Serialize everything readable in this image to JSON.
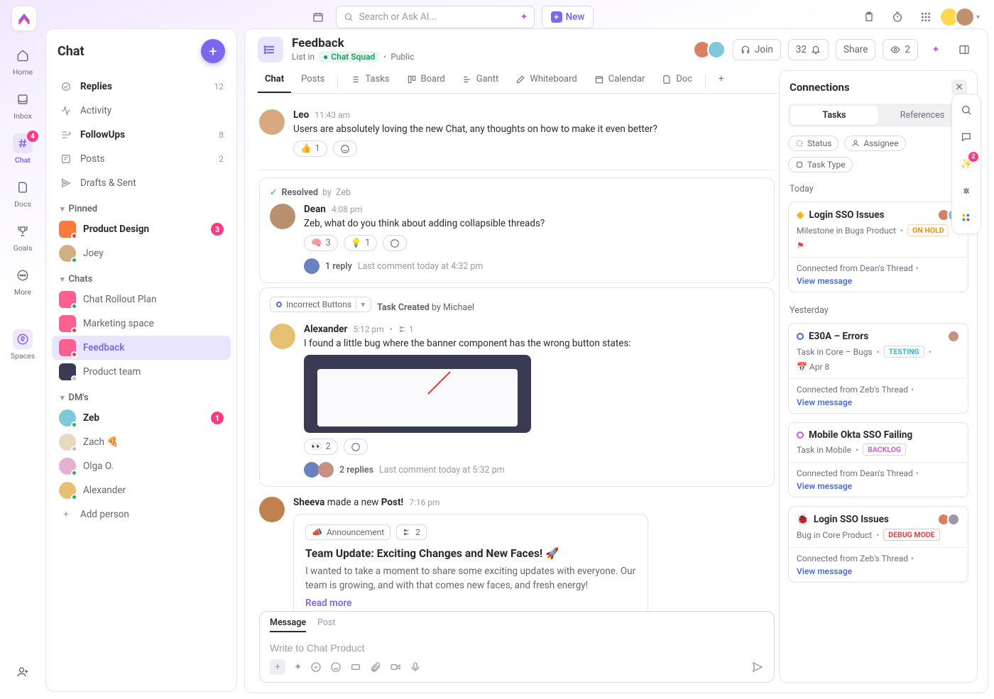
{
  "top": {
    "search_placeholder": "Search or Ask AI...",
    "new_label": "New"
  },
  "rail": {
    "items": [
      {
        "label": "Home"
      },
      {
        "label": "Inbox"
      },
      {
        "label": "Chat",
        "badge": "4"
      },
      {
        "label": "Docs"
      },
      {
        "label": "Goals"
      },
      {
        "label": "More"
      }
    ],
    "spaces_label": "Spaces"
  },
  "panel": {
    "title": "Chat",
    "lists": [
      {
        "icon": "reply",
        "label": "Replies",
        "count": "12",
        "bold": true
      },
      {
        "icon": "activity",
        "label": "Activity"
      },
      {
        "icon": "follow",
        "label": "FollowUps",
        "count": "8",
        "bold": true
      },
      {
        "icon": "post",
        "label": "Posts",
        "count": "2"
      },
      {
        "icon": "draft",
        "label": "Drafts & Sent"
      }
    ],
    "pinned_h": "Pinned",
    "pinned": [
      {
        "label": "Product Design",
        "badge": "3",
        "color": "#ff7a3c",
        "bold": true
      },
      {
        "label": "Joey",
        "avatar": "#d0b080",
        "presence": "#27ae60"
      }
    ],
    "chats_h": "Chats",
    "chats": [
      {
        "label": "Chat Rollout Plan",
        "color": "#ff5f8f"
      },
      {
        "label": "Marketing space",
        "color": "#ff5f8f"
      },
      {
        "label": "Feedback",
        "color": "#ff5f8f",
        "selected": true
      },
      {
        "label": "Product team",
        "color": "#3a3a55"
      }
    ],
    "dms_h": "DM's",
    "dms": [
      {
        "label": "Zeb",
        "avatar": "#7fc8d8",
        "presence": "#27ae60",
        "badge": "1",
        "bold": true
      },
      {
        "label": "Zach 🍕",
        "avatar": "#e9d8c0",
        "presence": "#bdbdc8"
      },
      {
        "label": "Olga O.",
        "avatar": "#e6b0d0",
        "presence": "#27ae60"
      },
      {
        "label": "Alexander",
        "avatar": "#e6c070",
        "presence": "#27ae60"
      }
    ],
    "add_person": "Add person"
  },
  "header": {
    "title": "Feedback",
    "sub_prefix": "List in",
    "folder": "Chat Squad",
    "visibility": "Public",
    "join": "Join",
    "count": "32",
    "share": "Share",
    "views_count": "2"
  },
  "views": [
    {
      "label": "Chat",
      "active": true
    },
    {
      "label": "Posts"
    },
    {
      "label": "Tasks",
      "icon": "list"
    },
    {
      "label": "Board",
      "icon": "board"
    },
    {
      "label": "Gantt",
      "icon": "gantt"
    },
    {
      "label": "Whiteboard",
      "icon": "pen"
    },
    {
      "label": "Calendar",
      "icon": "cal"
    },
    {
      "label": "Doc",
      "icon": "doc"
    }
  ],
  "feed": {
    "m1": {
      "name": "Leo",
      "time": "11:43 am",
      "body": "Users are absolutely loving the new Chat, any thoughts on how to make it even better?",
      "react_emoji": "👍",
      "react_count": "1"
    },
    "thread1": {
      "resolved_by": "Zeb",
      "resolved_label": "Resolved",
      "name": "Dean",
      "time": "4:08 pm",
      "body": "Zeb, what do you think about adding collapsible threads?",
      "r1_emoji": "🧠",
      "r1_count": "3",
      "r2_emoji": "💡",
      "r2_count": "1",
      "reply_count": "1 reply",
      "reply_sub": "Last comment today at 4:32 pm"
    },
    "thread2": {
      "task_name": "Incorrect Buttons",
      "task_created": "Task Created",
      "task_author": "by Michael",
      "name": "Alexander",
      "time": "5:12 pm",
      "subtask": "1",
      "body": "I found a little bug where the banner component has the wrong button states:",
      "r1_emoji": "👀",
      "r1_count": "2",
      "reply_count": "2 replies",
      "reply_sub": "Last comment today at 5:32 pm"
    },
    "post": {
      "author": "Sheeva",
      "verb": " made a new ",
      "noun": "Post!",
      "time": "7:16 pm",
      "tag": "Announcement",
      "subtask": "2",
      "title": "Team Update: Exciting Changes and New Faces! 🚀",
      "body": "I wanted to take a moment to share some exciting updates with everyone. Our team is growing, and with that comes new faces, and fresh energy!",
      "read_more": "Read more"
    }
  },
  "composer": {
    "tab_message": "Message",
    "tab_post": "Post",
    "placeholder": "Write to Chat Product"
  },
  "connections": {
    "title": "Connections",
    "tab_tasks": "Tasks",
    "tab_refs": "References",
    "filters": [
      "Status",
      "Assignee",
      "Task Type"
    ],
    "today": "Today",
    "yesterday": "Yesterday",
    "cards": [
      {
        "icon_color": "#f7b500",
        "title": "Login SSO Issues",
        "sub": "Milestone in Bugs Product",
        "status": "ON HOLD",
        "status_color": "#ff8c00",
        "flag": true,
        "avatars": 2,
        "conn": "Connected from Dean's Thread",
        "link": "View message"
      },
      {
        "icon_color": "#4a6ee0",
        "title": "E30A – Errors",
        "sub": "Task in Core – Bugs",
        "status": "TESTING",
        "status_color": "#32b8c6",
        "date": "Apr 8",
        "avatars": 1,
        "conn": "Connected from Zeb's Thread",
        "link": "View message"
      },
      {
        "icon_color": "#c060e0",
        "title": "Mobile Okta SSO Failing",
        "sub": "Task in Mobile",
        "status": "BACKLOG",
        "status_color": "#d064c0",
        "avatars": 0,
        "conn": "Connected from Dean's Thread",
        "link": "View message"
      },
      {
        "icon_color": "#e04040",
        "title": "Login SSO Issues",
        "sub": "Bug in Core Product",
        "status": "DEBUG MODE",
        "status_color": "#e04040",
        "avatars": 2,
        "conn": "Connected from Zeb's Thread",
        "link": "View message"
      }
    ]
  },
  "frail_badge": "2"
}
